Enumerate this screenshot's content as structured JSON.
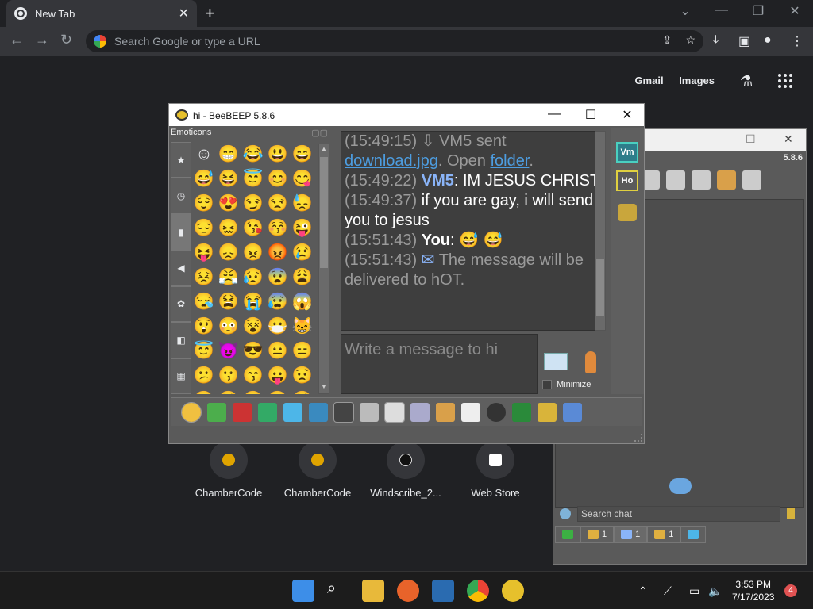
{
  "browser": {
    "tab_title": "New Tab",
    "tab_close": "✕",
    "new_tab": "+",
    "omnibox_placeholder": "Search Google or type a URL",
    "links": [
      "Gmail",
      "Images"
    ]
  },
  "shortcuts": [
    {
      "label": "ChamberCode"
    },
    {
      "label": "ChamberCode"
    },
    {
      "label": "Windscribe_2..."
    },
    {
      "label": "Web Store"
    }
  ],
  "main_window": {
    "title": "hi - BeeBEEP 5.8.6",
    "emoticons_label": "Emoticons",
    "emoticons": [
      "☺",
      "😁",
      "😂",
      "😃",
      "😄",
      "😅",
      "😆",
      "😇",
      "😊",
      "😋",
      "😌",
      "😍",
      "😏",
      "😒",
      "😓",
      "😔",
      "😖",
      "😘",
      "😚",
      "😜",
      "😝",
      "😞",
      "😠",
      "😡",
      "😢",
      "😣",
      "😤",
      "😥",
      "😨",
      "😩",
      "😪",
      "😫",
      "😭",
      "😰",
      "😱",
      "😲",
      "😳",
      "😵",
      "😷",
      "😸",
      "😇",
      "😈",
      "😎",
      "😐",
      "😑",
      "😕",
      "😗",
      "😙",
      "😛",
      "😟",
      "😦",
      "😧",
      "😬",
      "😮",
      "😯"
    ],
    "chat": [
      {
        "time": "(15:49:15)",
        "text": "VM5 sent",
        "link1": "download.jpg",
        "mid": ". Open",
        "link2": "folder",
        "end": "."
      },
      {
        "time": "(15:49:22)",
        "name": "VM5",
        "text": ": IM JESUS CHRIST"
      },
      {
        "time": "(15:49:37)",
        "text": "if you are gay, i will send you to jesus"
      },
      {
        "time": "(15:51:43)",
        "name": "You",
        "text": ":",
        "emoji": "😅 😅"
      },
      {
        "time": "(15:51:43)",
        "text": "The message will be delivered to hOT."
      }
    ],
    "compose_placeholder": "Write a message to hi",
    "minimize_label": "Minimize",
    "side": {
      "vm": "Vm",
      "ho": "Ho"
    }
  },
  "second_window": {
    "version": "5.8.6",
    "search_placeholder": "Search chat",
    "tabs": [
      {
        "count": ""
      },
      {
        "count": "1"
      },
      {
        "count": "1"
      },
      {
        "count": "1"
      },
      {
        "count": ""
      }
    ]
  },
  "taskbar": {
    "time": "3:53 PM",
    "date": "7/17/2023",
    "notifications": "4"
  }
}
